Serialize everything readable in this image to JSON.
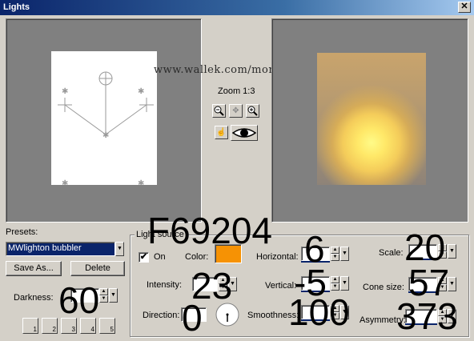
{
  "window": {
    "title": "Lights",
    "close_glyph": "✕"
  },
  "watermark": "www.wallek.com/monica/",
  "zoom": {
    "label": "Zoom 1:3",
    "buttons": [
      {
        "name": "zoom-out-icon",
        "glyph": "−"
      },
      {
        "name": "hand-icon",
        "glyph": "✥"
      },
      {
        "name": "zoom-in-icon",
        "glyph": "+"
      }
    ]
  },
  "preview_toggle": {
    "hand_glyph": "☝",
    "eye_glyph": "👁"
  },
  "presets": {
    "label": "Presets:",
    "selected": "MWlighton bubbler",
    "save_as": "Save As...",
    "delete": "Delete",
    "darkness_label": "Darkness:",
    "darkness_value": "60",
    "slots": [
      "1",
      "2",
      "3",
      "4",
      "5"
    ]
  },
  "light_source": {
    "group_label": "Light source",
    "on_label": "On",
    "on_checked": true,
    "check_glyph": "✔",
    "color_label": "Color:",
    "color_hex_display": "F69204",
    "color": "#f69204",
    "intensity_label": "Intensity:",
    "intensity_value": "23",
    "direction_label": "Direction:",
    "direction_value": "0",
    "horizontal_label": "Horizontal:",
    "horizontal_value": "6",
    "vertical_label": "Vertical:",
    "vertical_value": "-5",
    "smoothness_label": "Smoothness:",
    "smoothness_value": "100",
    "scale_label": "Scale:",
    "scale_value": "20",
    "cone_label": "Cone size:",
    "cone_value": "57",
    "asymmetry_label": "Asymmetry:",
    "asymmetry_value": "373"
  },
  "colors": {
    "dialog": "#d4d0c8",
    "titlebar": "#0a246a",
    "accent": "#f69204"
  }
}
